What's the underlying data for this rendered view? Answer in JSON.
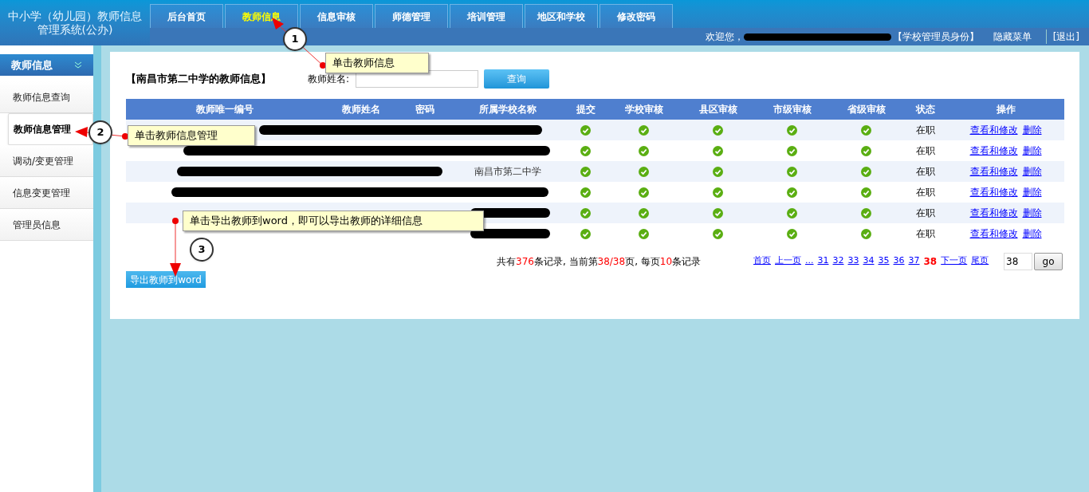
{
  "header": {
    "title_line1": "中小学（幼儿园）教师信息",
    "title_line2": "管理系统(公办)",
    "tabs": [
      {
        "label": "后台首页",
        "selected": false
      },
      {
        "label": "教师信息",
        "selected": true
      },
      {
        "label": "信息审核",
        "selected": false
      },
      {
        "label": "师德管理",
        "selected": false
      },
      {
        "label": "培训管理",
        "selected": false
      },
      {
        "label": "地区和学校",
        "selected": false
      },
      {
        "label": "修改密码",
        "selected": false
      }
    ],
    "welcome": "欢迎您，",
    "role": "【学校管理员身份】",
    "hide_menu": "隐藏菜单",
    "logout": "[退出]"
  },
  "sidebar": {
    "title": "教师信息",
    "items": [
      {
        "label": "教师信息查询",
        "selected": false
      },
      {
        "label": "教师信息管理",
        "selected": true
      },
      {
        "label": "调动/变更管理",
        "selected": false
      },
      {
        "label": "信息变更管理",
        "selected": false
      },
      {
        "label": "管理员信息",
        "selected": false
      }
    ]
  },
  "panel": {
    "title": "【南昌市第二中学的教师信息】",
    "search_label": "教师姓名:",
    "search_button": "查询"
  },
  "table": {
    "columns": [
      "教师唯一编号",
      "教师姓名",
      "密码",
      "所属学校名称",
      "提交",
      "学校审核",
      "县区审核",
      "市级审核",
      "省级审核",
      "状态",
      "操作"
    ],
    "rows": [
      {
        "checks": [
          true,
          true,
          true,
          true,
          true
        ],
        "status": "在职",
        "view": "查看和修改",
        "delete": "删除"
      },
      {
        "checks": [
          true,
          true,
          true,
          true,
          true
        ],
        "status": "在职",
        "view": "查看和修改",
        "delete": "删除"
      },
      {
        "school": "南昌市第二中学",
        "checks": [
          true,
          true,
          true,
          true,
          true
        ],
        "status": "在职",
        "view": "查看和修改",
        "delete": "删除"
      },
      {
        "checks": [
          true,
          true,
          true,
          true,
          true
        ],
        "status": "在职",
        "view": "查看和修改",
        "delete": "删除"
      },
      {
        "checks": [
          true,
          true,
          true,
          true,
          true
        ],
        "status": "在职",
        "view": "查看和修改",
        "delete": "删除"
      },
      {
        "checks": [
          true,
          true,
          true,
          true,
          true
        ],
        "status": "在职",
        "view": "查看和修改",
        "delete": "删除"
      }
    ]
  },
  "summary": {
    "p1": "共有",
    "total": "376",
    "p2": "条记录, 当前第",
    "page": "38/38",
    "p3": "页, 每页",
    "per_page": "10",
    "p4": "条记录"
  },
  "pagination": [
    {
      "label": "首页",
      "selected": false
    },
    {
      "label": "上一页",
      "selected": false
    },
    {
      "label": "...",
      "selected": false
    },
    {
      "label": "31",
      "selected": false
    },
    {
      "label": "32",
      "selected": false
    },
    {
      "label": "33",
      "selected": false
    },
    {
      "label": "34",
      "selected": false
    },
    {
      "label": "35",
      "selected": false
    },
    {
      "label": "36",
      "selected": false
    },
    {
      "label": "37",
      "selected": false
    },
    {
      "label": "38",
      "selected": true
    },
    {
      "label": "下一页",
      "selected": false
    },
    {
      "label": "尾页",
      "selected": false
    }
  ],
  "goto": {
    "value": "38",
    "button": "go"
  },
  "export_button": "导出教师到word",
  "callouts": [
    {
      "number": "1",
      "text": "单击教师信息"
    },
    {
      "number": "2",
      "text": "单击教师信息管理"
    },
    {
      "number": "3",
      "text": "单击导出教师到word，即可以导出教师的详细信息"
    }
  ]
}
